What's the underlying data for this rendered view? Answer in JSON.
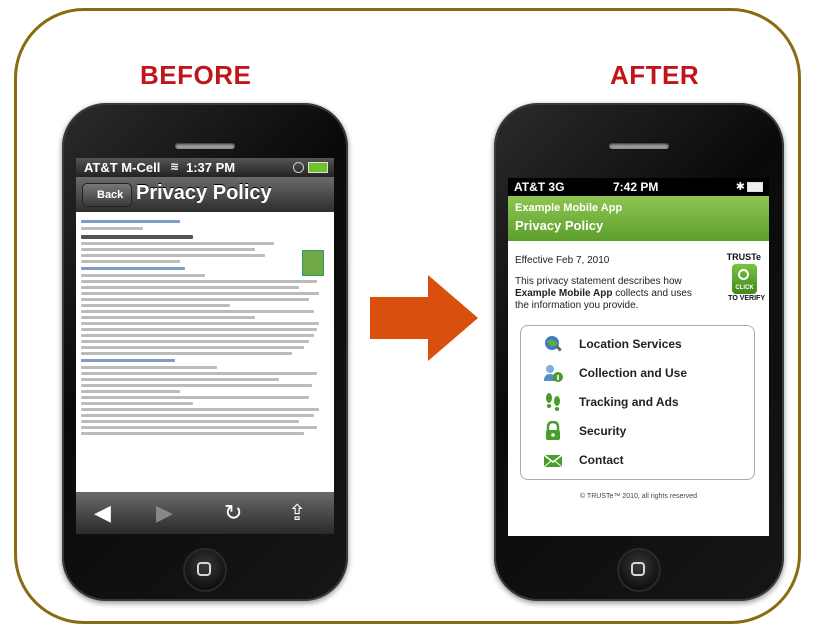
{
  "headings": {
    "before": "BEFORE",
    "after": "AFTER"
  },
  "colors": {
    "frame": "#8b6b12",
    "heading": "#c0161b",
    "arrow": "#d94f0e",
    "app_green": "#6aae35"
  },
  "before_phone": {
    "status": {
      "carrier": "AT&T M-Cell",
      "time": "1:37 PM",
      "wifi_icon": "wifi-icon",
      "battery_icon": "battery-icon"
    },
    "nav": {
      "back": "Back",
      "title": "Privacy Policy"
    },
    "toolbar": [
      "back-arrow-icon",
      "forward-arrow-icon",
      "reload-icon",
      "share-icon"
    ]
  },
  "after_phone": {
    "status": {
      "carrier": "AT&T  3G",
      "time": "7:42 PM",
      "bluetooth_icon": "bluetooth-icon",
      "battery_icon": "battery-icon"
    },
    "header": {
      "app_name": "Example Mobile App",
      "title": "Privacy Policy"
    },
    "effective": "Effective Feb 7, 2010",
    "description": {
      "pre": "This privacy statement describes how ",
      "bold": "Example Mobile App",
      "post": " collects and uses the information you provide."
    },
    "truste": {
      "label": "TRUSTe",
      "click": "CLICK",
      "verify": "TO VERIFY"
    },
    "menu": [
      {
        "label": "Location Services",
        "icon": "location-search-icon"
      },
      {
        "label": "Collection and Use",
        "icon": "user-info-icon"
      },
      {
        "label": "Tracking and Ads",
        "icon": "footprints-icon"
      },
      {
        "label": "Security",
        "icon": "lock-icon"
      },
      {
        "label": "Contact",
        "icon": "envelope-icon"
      }
    ],
    "copyright": "© TRUSTe™ 2010, all rights reserved"
  }
}
